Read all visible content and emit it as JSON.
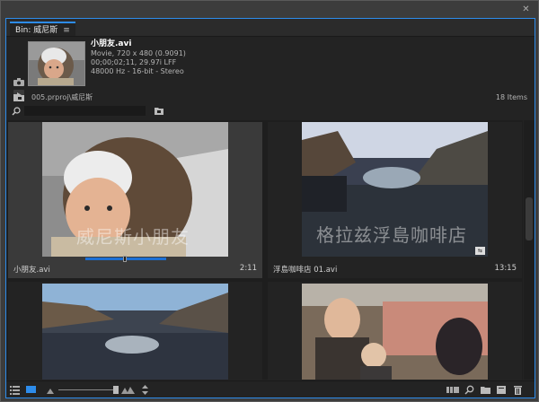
{
  "panel": {
    "tab_label": "Bin: 威尼斯",
    "menu_glyph": "≡",
    "close_glyph": "✕"
  },
  "clip_info": {
    "name": "小朋友.avi",
    "line1": "Movie, 720 x 480 (0.9091)",
    "line2": "00;00;02;11, 29.97i LFF",
    "line3": "48000 Hz - 16-bit - Stereo"
  },
  "path": {
    "text": "005.prproj\\威尼斯",
    "item_count": "18 Items"
  },
  "search": {
    "value": "",
    "placeholder": ""
  },
  "clips": [
    {
      "name": "小朋友.avi",
      "duration": "2:11",
      "watermark": "威尼斯小朋友",
      "selected": true,
      "scrub_progress": 0.65
    },
    {
      "name": "浮島咖啡店 01.avi",
      "duration": "13:15",
      "watermark": "格拉兹浮島咖啡店",
      "selected": false
    },
    {
      "name": "",
      "duration": "",
      "watermark": "",
      "selected": false
    },
    {
      "name": "",
      "duration": "",
      "watermark": "",
      "selected": false
    }
  ],
  "icons": {
    "camera": "camera-icon",
    "play": "play-icon",
    "folder": "folder-icon",
    "search": "search-icon",
    "new_bin": "new-bin-icon",
    "list_view": "list-view-icon",
    "icon_view": "icon-view-icon",
    "zoom_small": "zoom-small-icon",
    "zoom_large": "zoom-large-icon",
    "sort": "sort-icon",
    "automate": "automate-to-sequence-icon",
    "find": "find-icon",
    "new_bin_bottom": "new-bin-icon",
    "new_item": "new-item-icon",
    "clear": "trash-icon"
  },
  "colors": {
    "accent": "#2d8ceb",
    "scrub": "#1c6fd4"
  }
}
